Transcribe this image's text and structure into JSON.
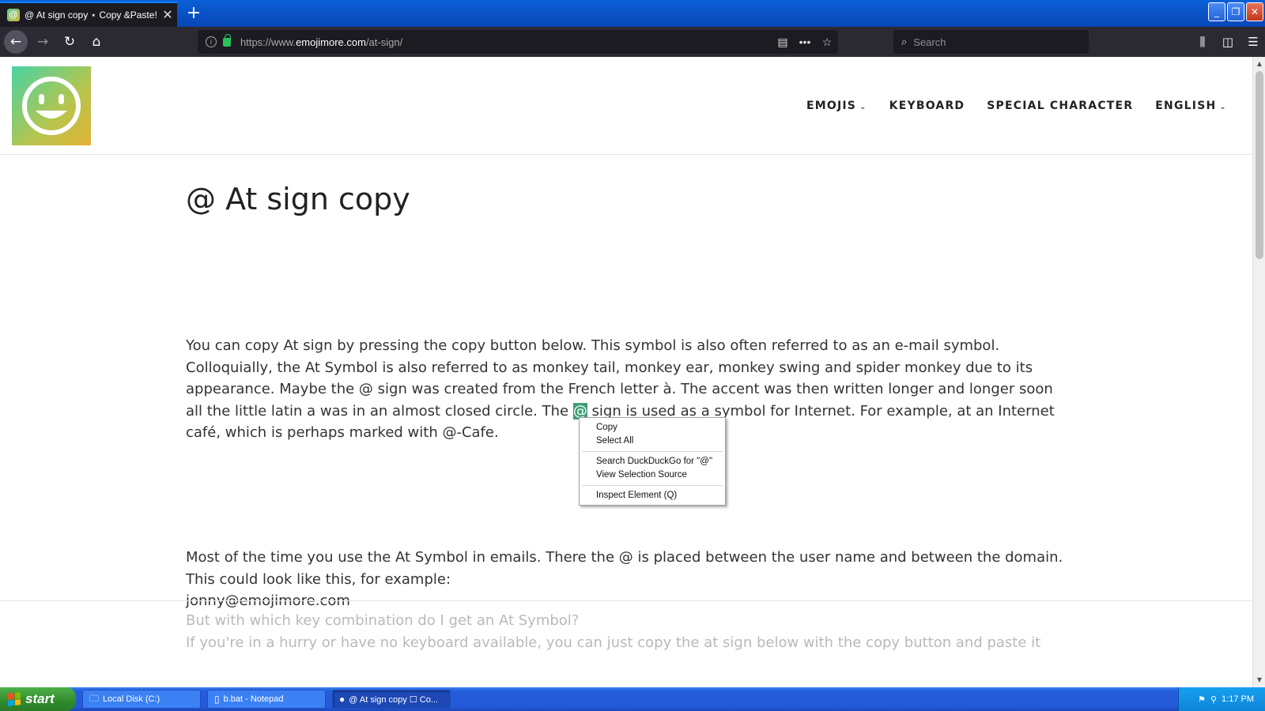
{
  "browser": {
    "tab_title": "@ At sign copy ⋆ Copy &Paste!",
    "favicon_glyph": "@",
    "new_tab": "+",
    "url_prefix": "https://www.",
    "url_domain": "emojimore.com",
    "url_path": "/at-sign/",
    "search_placeholder": "Search"
  },
  "site": {
    "menu": [
      {
        "label": "EMOJIS",
        "caret": "⌄"
      },
      {
        "label": "KEYBOARD"
      },
      {
        "label": "SPECIAL CHARACTER"
      },
      {
        "label": "ENGLISH",
        "caret": "⌄"
      }
    ],
    "heading": "@ At sign copy",
    "p1_a": "You can copy At sign by pressing the copy button below. This symbol is also often referred to as an e-mail symbol. Colloquially, the At Symbol is also referred to as monkey tail, monkey ear, monkey swing and spider monkey due to its appearance. Maybe the @ sign was created from the French letter à. The accent was then written longer and longer soon all the little latin a was in an almost closed circle. The ",
    "p1_selected": "@",
    "p1_b": " sign is used as a symbol for Internet. For example, at an Internet café, which is perhaps marked with @-Cafe.",
    "p2_a": "Most of the time you use the At Symbol in emails. There the @ is placed between the user name and between the domain. This could look like this, for example:",
    "p2_email": "jonny@emojimore.com",
    "faded_1": "But with which key combination do I get an At Symbol?",
    "faded_2": "If you're in a hurry or have no keyboard available, you can just copy the at sign below with the copy button and paste it"
  },
  "context_menu": {
    "copy": "Copy",
    "select_all": "Select All",
    "search": "Search DuckDuckGo for \"@\"",
    "view_source": "View Selection Source",
    "inspect": "Inspect Element (Q)"
  },
  "taskbar": {
    "start": "start",
    "items": [
      "Local Disk (C:)",
      "b.bat - Notepad",
      "@ At sign copy ☐ Co..."
    ],
    "clock": "1:17 PM"
  },
  "colors": {
    "selection": "#3f9e76",
    "taskbar": "#245edb",
    "browser_dark": "#2b2a33"
  }
}
